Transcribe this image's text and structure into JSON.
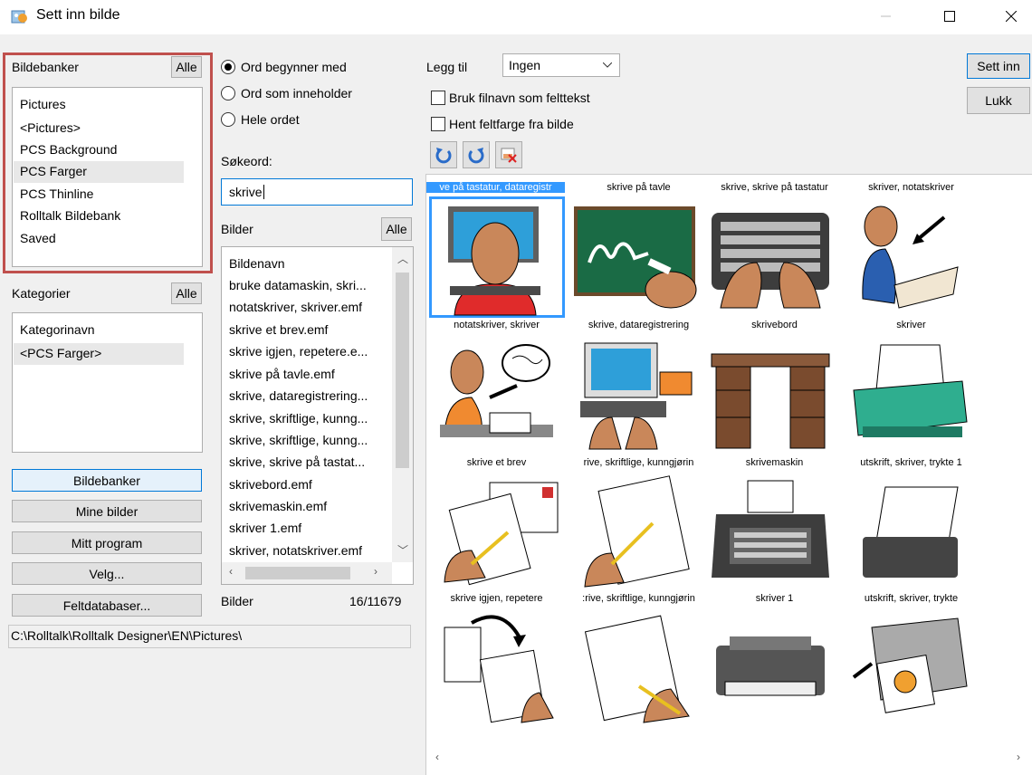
{
  "window": {
    "title": "Sett inn bilde",
    "minimize_icon": "minimize-icon",
    "maximize_icon": "maximize-icon",
    "close_icon": "close-icon"
  },
  "banks": {
    "label": "Bildebanker",
    "all_button": "Alle",
    "items": [
      "Pictures",
      "<Pictures>",
      "PCS Background",
      "PCS Farger",
      "PCS Thinline",
      "Rolltalk Bildebank",
      "Saved"
    ],
    "selected": "PCS Farger"
  },
  "categories": {
    "label": "Kategorier",
    "all_button": "Alle",
    "items": [
      "Kategorinavn",
      "<PCS Farger>"
    ]
  },
  "left_buttons": {
    "banks": "Bildebanker",
    "my_images": "Mine bilder",
    "my_program": "Mitt program",
    "choose": "Velg...",
    "field_db": "Feltdatabaser..."
  },
  "path": "C:\\Rolltalk\\Rolltalk Designer\\EN\\Pictures\\",
  "search": {
    "options": [
      "Ord begynner med",
      "Ord som inneholder",
      "Hele ordet"
    ],
    "selected_option": "Ord begynner med",
    "keyword_label": "Søkeord:",
    "keyword_value": "skrive"
  },
  "images_list": {
    "label": "Bilder",
    "all_button": "Alle",
    "items": [
      "Bildenavn",
      "bruke datamaskin, skri...",
      "notatskriver, skriver.emf",
      "skrive et brev.emf",
      "skrive igjen, repetere.e...",
      "skrive på tavle.emf",
      "skrive, dataregistrering...",
      "skrive, skriftlige, kunng...",
      "skrive, skriftlige, kunng...",
      "skrive, skrive på tastat...",
      "skrivebord.emf",
      "skrivemaskin.emf",
      "skriver 1.emf",
      "skriver, notatskriver.emf"
    ],
    "footer_label": "Bilder",
    "count": "16/11679"
  },
  "options": {
    "add_label": "Legg til",
    "add_value": "Ingen",
    "use_filename": "Bruk filnavn som felttekst",
    "field_color": "Hent feltfarge fra bilde"
  },
  "actions": {
    "insert": "Sett inn",
    "close": "Lukk"
  },
  "gallery": {
    "captions": [
      "ve på tastatur, dataregistr",
      "skrive på tavle",
      "skrive, skrive på tastatur",
      "skriver, notatskriver",
      "notatskriver, skriver",
      "skrive, dataregistrering",
      "skrivebord",
      "skriver",
      "skrive et brev",
      "rive, skriftlige, kunngjørin",
      "skrivemaskin",
      "utskrift, skriver, trykte 1",
      "skrive igjen, repetere",
      ":rive, skriftlige, kunngjørin",
      "skriver 1",
      "utskrift, skriver, trykte"
    ]
  },
  "colors": {
    "highlight_frame": "#c0504d",
    "selection": "#3399ff",
    "accent": "#0078d7"
  }
}
